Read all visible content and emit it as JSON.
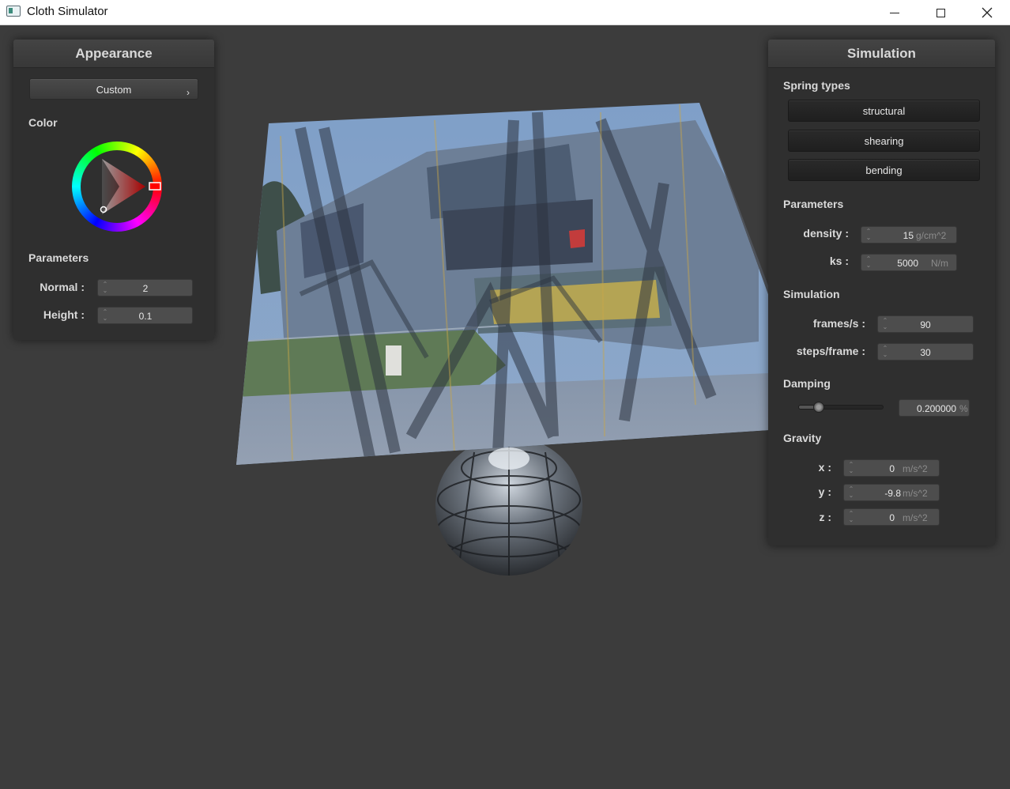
{
  "window": {
    "title": "Cloth Simulator"
  },
  "appearance": {
    "header": "Appearance",
    "preset": "Custom",
    "preset_arrow": "›",
    "color_label": "Color",
    "parameters_label": "Parameters",
    "normal_label": "Normal :",
    "normal_value": "2",
    "height_label": "Height :",
    "height_value": "0.1"
  },
  "simulation": {
    "header": "Simulation",
    "spring_types_label": "Spring types",
    "spring_buttons": [
      "structural",
      "shearing",
      "bending"
    ],
    "parameters_label": "Parameters",
    "density_label": "density :",
    "density_value": "15",
    "density_unit": "g/cm^2",
    "ks_label": "ks :",
    "ks_value": "5000",
    "ks_unit": "N/m",
    "simulation_label": "Simulation",
    "fps_label": "frames/s :",
    "fps_value": "90",
    "steps_label": "steps/frame :",
    "steps_value": "30",
    "damping_label": "Damping",
    "damping_value": "0.200000",
    "damping_unit": "%",
    "damping_fraction": 0.2,
    "gravity_label": "Gravity",
    "x_label": "x :",
    "x_value": "0",
    "y_label": "y :",
    "y_value": "-9.8",
    "z_label": "z :",
    "z_value": "0",
    "gravity_unit": "m/s^2"
  },
  "colors": {
    "background": "#3c3c3c",
    "panel": "#2f2f2f",
    "selected_color": "#ff0000"
  }
}
